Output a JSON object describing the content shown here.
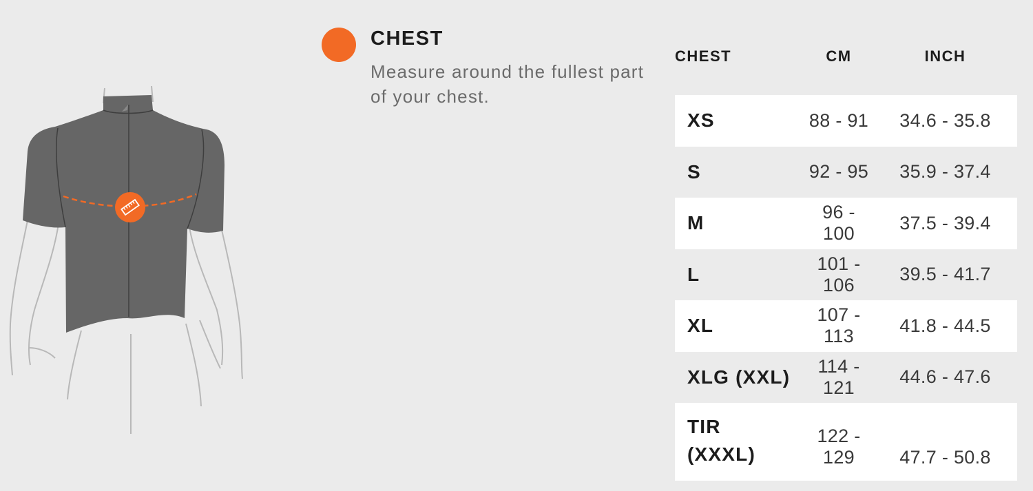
{
  "colors": {
    "accent": "#f26a25",
    "shirt": "#666666",
    "background": "#ebebeb"
  },
  "icons": {
    "legend_marker": "orange-dot-icon",
    "measure_marker": "ruler-icon"
  },
  "legend": {
    "title": "CHEST",
    "description": "Measure around the fullest part of your chest."
  },
  "table": {
    "headers": {
      "size": "CHEST",
      "cm": "CM",
      "inch": "INCH"
    },
    "rows": [
      {
        "size": "XS",
        "cm": "88 - 91",
        "inch": "34.6 - 35.8"
      },
      {
        "size": "S",
        "cm": "92 - 95",
        "inch": "35.9 - 37.4"
      },
      {
        "size": "M",
        "cm": "96 - 100",
        "inch": "37.5 - 39.4"
      },
      {
        "size": "L",
        "cm": "101 - 106",
        "inch": "39.5 - 41.7"
      },
      {
        "size": "XL",
        "cm": "107 - 113",
        "inch": "41.8 - 44.5"
      },
      {
        "size": "XLG (XXL)",
        "cm": "114 - 121",
        "inch": "44.6 - 47.6"
      },
      {
        "size": "TIR (XXXL)",
        "cm": "122 - 129",
        "inch": "47.7 - 50.8"
      }
    ]
  }
}
